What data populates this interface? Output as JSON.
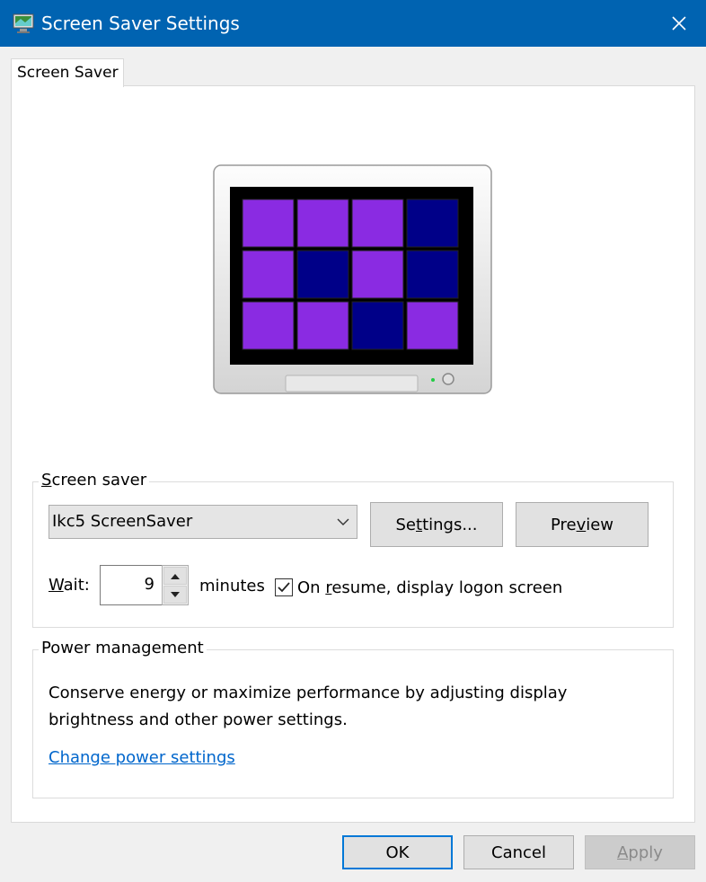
{
  "window": {
    "title": "Screen Saver Settings",
    "close_icon": "close-icon",
    "app_icon": "screen-saver-settings-icon",
    "accent_color": "#0063b1"
  },
  "tabs": [
    {
      "label": "Screen Saver",
      "selected": true
    }
  ],
  "preview": {
    "grid_colors": [
      [
        "#8a2be2",
        "#8a2be2",
        "#8a2be2",
        "#000088"
      ],
      [
        "#8a2be2",
        "#000088",
        "#8a2be2",
        "#000088"
      ],
      [
        "#8a2be2",
        "#8a2be2",
        "#000088",
        "#8a2be2"
      ]
    ]
  },
  "screen_saver_group": {
    "legend_pre": "",
    "legend_key": "S",
    "legend_post": "creen saver",
    "selected_value": "Ikc5 ScreenSaver",
    "settings_btn": {
      "pre": "Se",
      "key": "t",
      "post": "tings..."
    },
    "preview_btn": {
      "pre": "Pre",
      "key": "v",
      "post": "iew"
    },
    "wait_label": {
      "pre": "",
      "key": "W",
      "post": "ait:"
    },
    "wait_value": "9",
    "minutes_label": "minutes",
    "resume_checked": true,
    "resume_label": {
      "pre": "On ",
      "key": "r",
      "post": "esume, display logon screen"
    }
  },
  "power_group": {
    "legend": "Power management",
    "description": "Conserve energy or maximize performance by adjusting display brightness and other power settings.",
    "link_text": "Change power settings",
    "link_color": "#0066cc"
  },
  "footer": {
    "ok_label": "OK",
    "cancel_label": "Cancel",
    "apply_label": {
      "pre": "",
      "key": "A",
      "post": "pply"
    }
  }
}
